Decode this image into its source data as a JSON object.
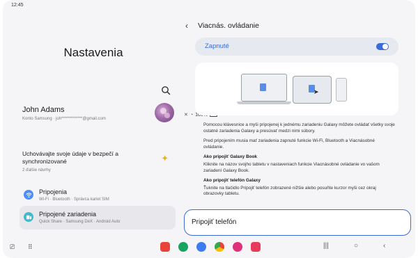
{
  "status_bar": {
    "time": "12:45",
    "battery": "100%"
  },
  "left": {
    "title": "Nastavenia",
    "account": {
      "name": "John Adams",
      "sub": "Konto Samsung  ·  joh*************@gmail.com"
    },
    "suggestion": {
      "title": "Uchovávajte svoje údaje v bezpečí a synchronizované",
      "sub": "2 ďalšie návrhy"
    },
    "items": [
      {
        "label": "Pripojenia",
        "sub": "Wi-Fi  ·  Bluetooth  ·  Správca kariet SIM",
        "icon": "wifi-icon",
        "color": "#4e8ef5"
      },
      {
        "label": "Pripojené zariadenia",
        "sub": "Quick Share  ·  Samsung DeX  ·  Android Auto",
        "icon": "connected-devices-icon",
        "color": "#43b9c9"
      }
    ]
  },
  "right": {
    "title": "Viacnás. ovládanie",
    "toggle_label": "Zapnuté",
    "toggle_state": true,
    "info": {
      "p1": "Pomocou klávesnice a myši pripojenej k jednému zariadeniu Galaxy môžete ovládať všetky svoje ostatné zariadenia Galaxy a presúvať medzi nimi súbory.",
      "p2": "Pred pripojením musia mať zariadenia zapnuté funkcie Wi-Fi, Bluetooth a Viacnásobné ovládanie.",
      "h3": "Ako pripojiť Galaxy Book",
      "p3": "Kliknite na názov svojho tabletu v nastaveniach funkcie Viacnásobné ovládanie vo vašom zariadení Galaxy Book.",
      "h4": "Ako pripojiť telefón Galaxy",
      "p4": "Ťuknite na tlačidlo Pripojiť telefón zobrazené nižšie alebo posuňte kurzor myši cez okraj obrazovky tabletu."
    },
    "connect_button": "Pripojiť telefón"
  },
  "colors": {
    "accent": "#3b6bd6",
    "background": "#f5f5f7"
  }
}
